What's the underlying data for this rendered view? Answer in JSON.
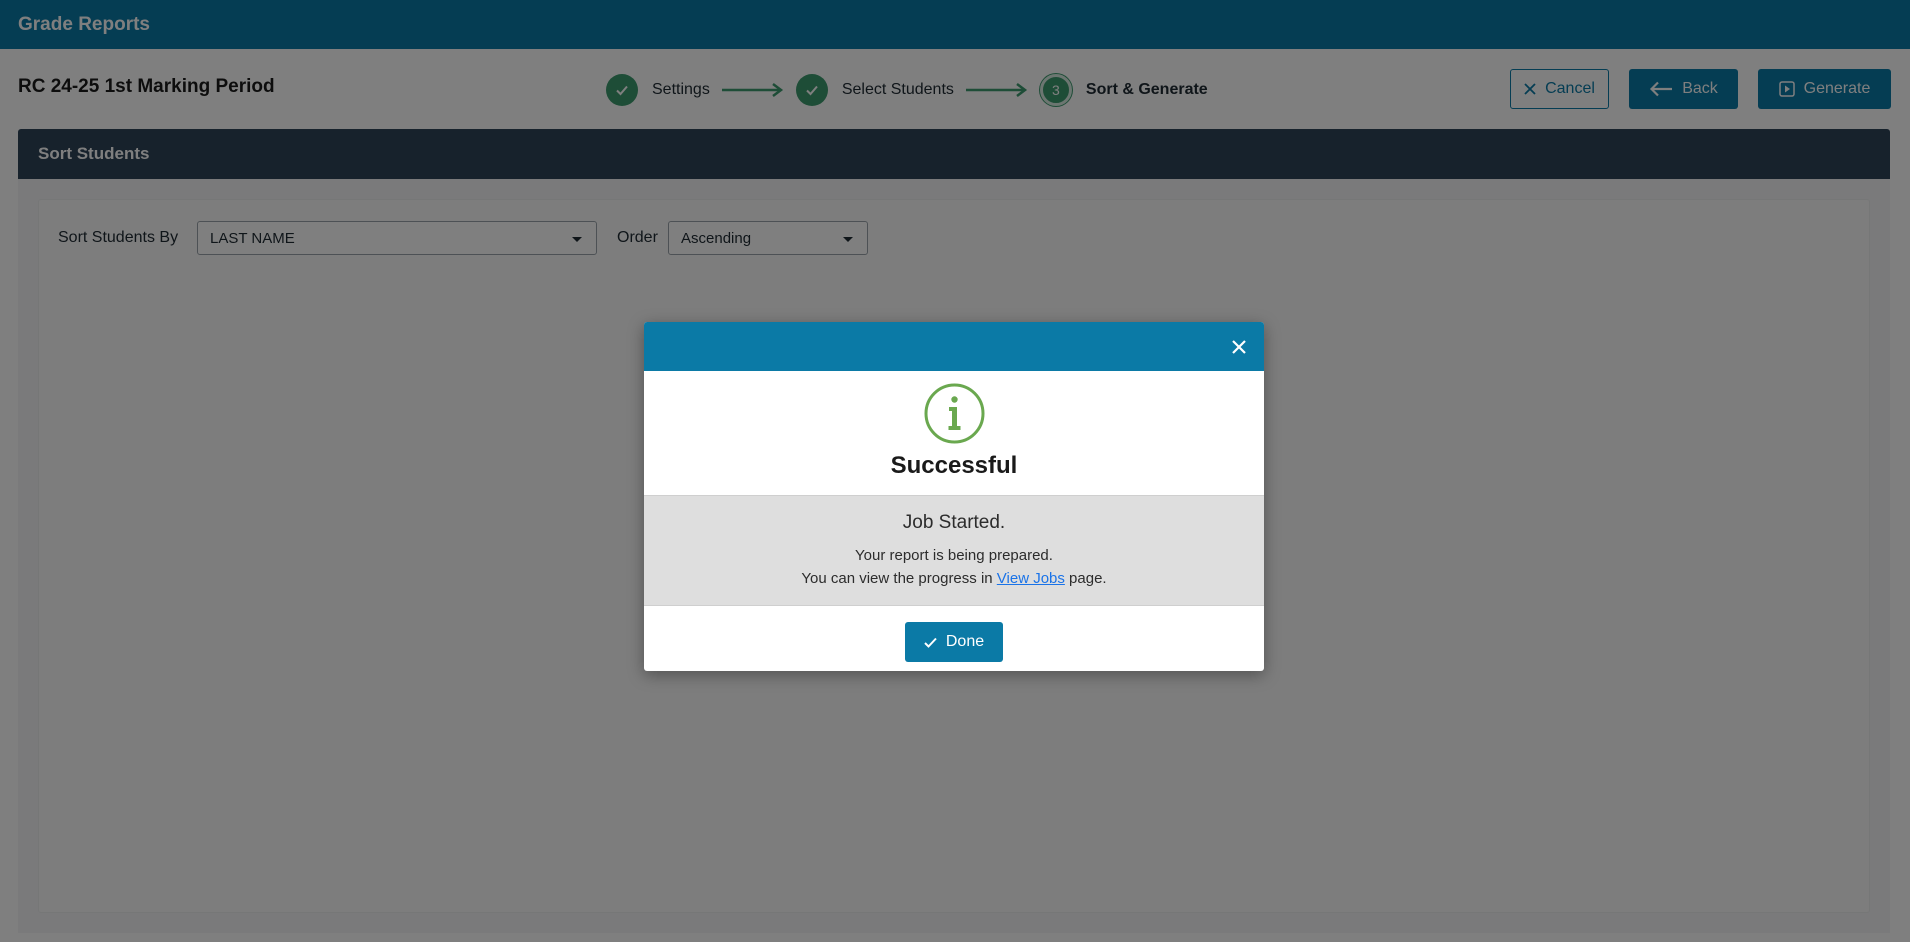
{
  "header": {
    "title": "Grade Reports"
  },
  "subbar": {
    "report_name": "RC 24-25 1st Marking Period",
    "steps": [
      {
        "label": "Settings",
        "status": "done"
      },
      {
        "label": "Select Students",
        "status": "done"
      },
      {
        "label": "Sort & Generate",
        "status": "current",
        "number": "3"
      }
    ],
    "buttons": {
      "cancel": "Cancel",
      "back": "Back",
      "generate": "Generate"
    }
  },
  "panel": {
    "title": "Sort Students",
    "sort_by_label": "Sort Students By",
    "sort_by_value": "LAST NAME",
    "order_label": "Order",
    "order_value": "Ascending"
  },
  "modal": {
    "heading": "Successful",
    "message_title": "Job Started.",
    "message_line1": "Your report is being prepared.",
    "message_line2_prefix": "You can view the progress in ",
    "message_link": "View Jobs",
    "message_line2_suffix": " page.",
    "done_label": "Done",
    "icon": "info-circle-icon"
  },
  "colors": {
    "primary": "#0b7aa6",
    "panel_header": "#2f4559",
    "step_done": "#3d9a6e",
    "info_icon": "#6aa84f"
  }
}
